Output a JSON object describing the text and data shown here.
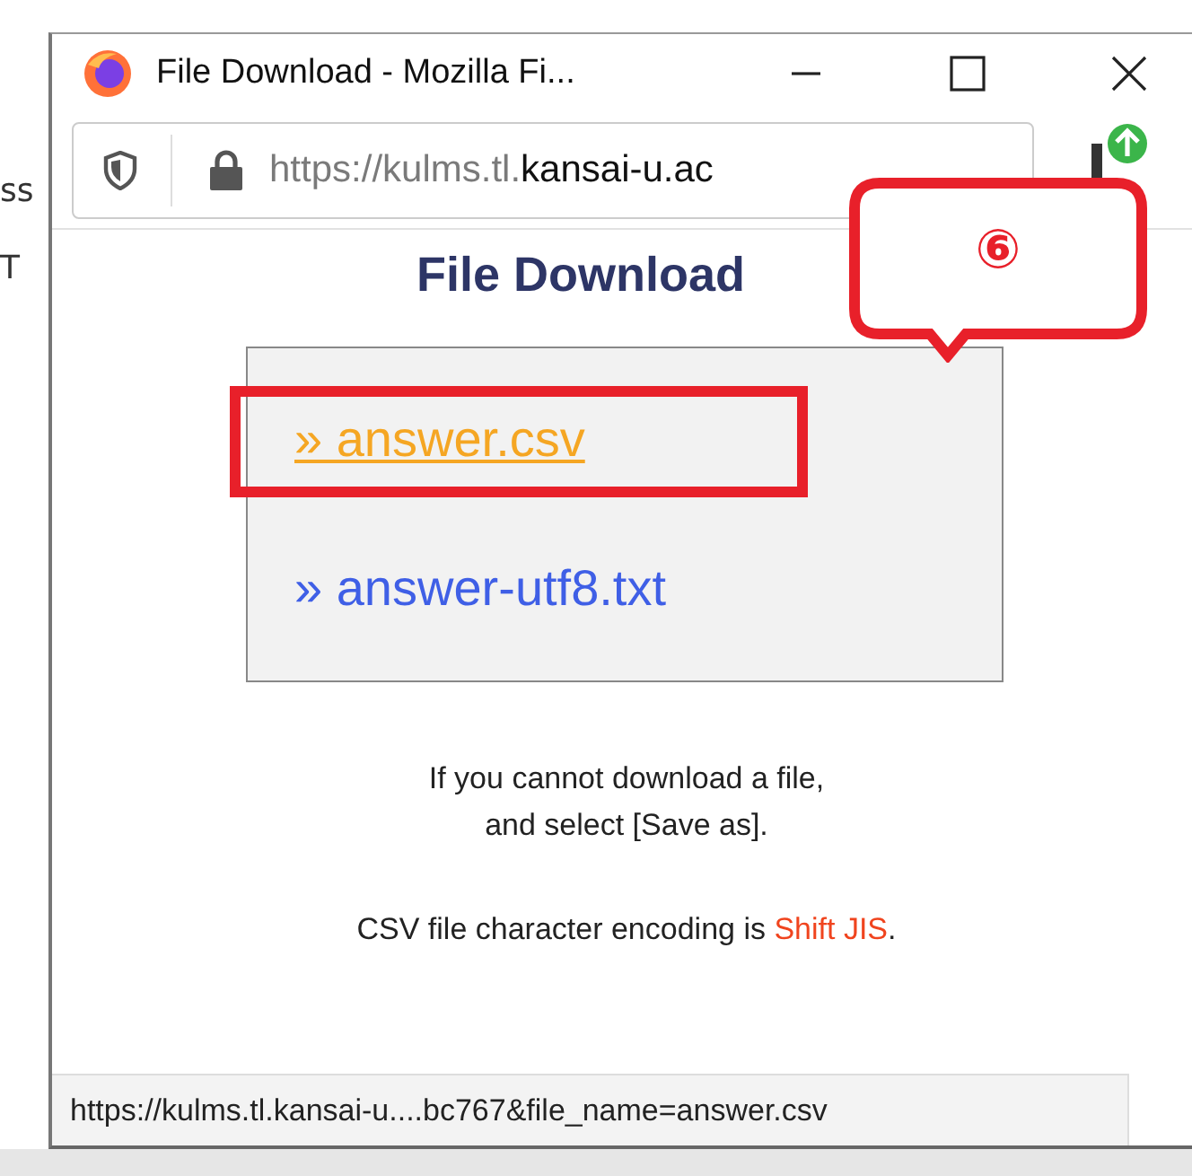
{
  "background_page": {
    "fragments": [
      "ss",
      "T"
    ]
  },
  "window": {
    "title": "File Download - Mozilla Fi..."
  },
  "address_bar": {
    "url_muted": "https://kulms.tl.",
    "url_host": "kansai-u.ac"
  },
  "page": {
    "heading": "File Download",
    "links": [
      {
        "label": "» answer.csv",
        "hovered": true,
        "boxed": true
      },
      {
        "label": "» answer-utf8.txt",
        "hovered": false,
        "boxed": false
      }
    ],
    "help_lines": [
      "If you cannot download a file,",
      "and select [Save as]."
    ],
    "encoding_note": "CSV file character encoding is **Shift JIS**."
  },
  "status_bar": {
    "text": "https://kulms.tl.kansai-u....bc767&file_name=answer.csv"
  },
  "annotations": [
    {
      "kind": "callout",
      "label": "⑥"
    }
  ]
}
